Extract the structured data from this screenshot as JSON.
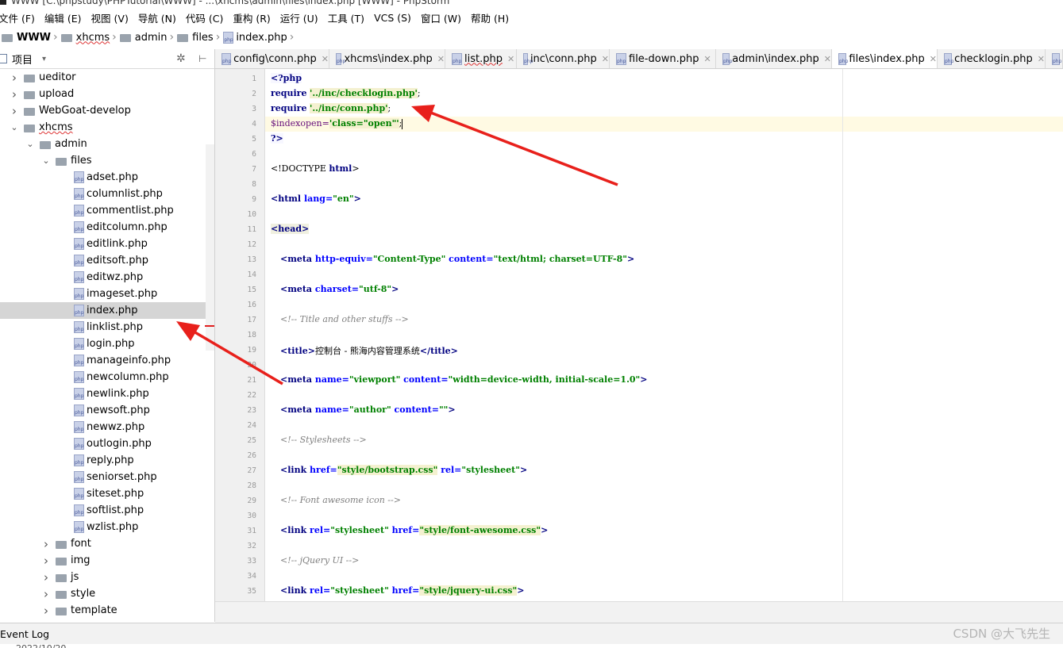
{
  "window": {
    "title": "WWW [C:\\phpstudy\\PHPTutorial\\WWW] - ...\\xhcms\\admin\\files\\index.php [WWW] - PhpStorm"
  },
  "menu": [
    "文件 (F)",
    "编辑 (E)",
    "视图 (V)",
    "导航 (N)",
    "代码 (C)",
    "重构 (R)",
    "运行 (U)",
    "工具 (T)",
    "VCS (S)",
    "窗口 (W)",
    "帮助 (H)"
  ],
  "breadcrumb": [
    "WWW",
    "xhcms",
    "admin",
    "files",
    "index.php"
  ],
  "project": {
    "label": "项目",
    "dropdown": "▾"
  },
  "tree": [
    {
      "label": "ueditor",
      "type": "folder",
      "level": 1,
      "open": false
    },
    {
      "label": "upload",
      "type": "folder",
      "level": 1,
      "open": false
    },
    {
      "label": "WebGoat-develop",
      "type": "folder",
      "level": 1,
      "open": false
    },
    {
      "label": "xhcms",
      "type": "folder",
      "level": 1,
      "open": true
    },
    {
      "label": "admin",
      "type": "folder",
      "level": 2,
      "open": true
    },
    {
      "label": "files",
      "type": "folder",
      "level": 3,
      "open": true
    },
    {
      "label": "adset.php",
      "type": "php",
      "level": 4
    },
    {
      "label": "columnlist.php",
      "type": "php",
      "level": 4
    },
    {
      "label": "commentlist.php",
      "type": "php",
      "level": 4
    },
    {
      "label": "editcolumn.php",
      "type": "php",
      "level": 4
    },
    {
      "label": "editlink.php",
      "type": "php",
      "level": 4
    },
    {
      "label": "editsoft.php",
      "type": "php",
      "level": 4
    },
    {
      "label": "editwz.php",
      "type": "php",
      "level": 4
    },
    {
      "label": "imageset.php",
      "type": "php",
      "level": 4
    },
    {
      "label": "index.php",
      "type": "php",
      "level": 4,
      "selected": true
    },
    {
      "label": "linklist.php",
      "type": "php",
      "level": 4
    },
    {
      "label": "login.php",
      "type": "php",
      "level": 4
    },
    {
      "label": "manageinfo.php",
      "type": "php",
      "level": 4
    },
    {
      "label": "newcolumn.php",
      "type": "php",
      "level": 4
    },
    {
      "label": "newlink.php",
      "type": "php",
      "level": 4
    },
    {
      "label": "newsoft.php",
      "type": "php",
      "level": 4
    },
    {
      "label": "newwz.php",
      "type": "php",
      "level": 4
    },
    {
      "label": "outlogin.php",
      "type": "php",
      "level": 4
    },
    {
      "label": "reply.php",
      "type": "php",
      "level": 4
    },
    {
      "label": "seniorset.php",
      "type": "php",
      "level": 4
    },
    {
      "label": "siteset.php",
      "type": "php",
      "level": 4
    },
    {
      "label": "softlist.php",
      "type": "php",
      "level": 4
    },
    {
      "label": "wzlist.php",
      "type": "php",
      "level": 4
    },
    {
      "label": "font",
      "type": "folder",
      "level": 3,
      "open": false
    },
    {
      "label": "img",
      "type": "folder",
      "level": 3,
      "open": false
    },
    {
      "label": "js",
      "type": "folder",
      "level": 3,
      "open": false
    },
    {
      "label": "style",
      "type": "folder",
      "level": 3,
      "open": false
    },
    {
      "label": "template",
      "type": "folder",
      "level": 3,
      "open": false
    }
  ],
  "tabs": [
    {
      "label": "config\\conn.php",
      "active": false
    },
    {
      "label": "xhcms\\index.php",
      "active": false
    },
    {
      "label": "list.php",
      "active": false
    },
    {
      "label": "inc\\conn.php",
      "active": false
    },
    {
      "label": "file-down.php",
      "active": false
    },
    {
      "label": "admin\\index.php",
      "active": false
    },
    {
      "label": "files\\index.php",
      "active": true
    },
    {
      "label": "checklogin.php",
      "active": false
    }
  ],
  "code": {
    "line_numbers": [
      "1",
      "2",
      "3",
      "4",
      "5",
      "6",
      "7",
      "8",
      "9",
      "10",
      "11",
      "12",
      "13",
      "14",
      "15",
      "16",
      "17",
      "18",
      "19",
      "20",
      "21",
      "22",
      "23",
      "24",
      "25",
      "26",
      "27",
      "28",
      "29",
      "30",
      "31",
      "32",
      "33",
      "34",
      "35"
    ],
    "l1": "<?php",
    "l2_kw": "require",
    "l2_str": "'../inc/checklogin.php'",
    "l2_end": ";",
    "l3_kw": "require",
    "l3_str": "'../inc/conn.php'",
    "l3_end": ";",
    "l4_var": "$index",
    "l4_mid": "open=",
    "l4_str": "'class=\"open\"'",
    "l4_end": ";",
    "l5": "?>",
    "l7_a": "<!DOCTYPE ",
    "l7_b": "html",
    "l7_c": ">",
    "l9_tag": "<html ",
    "l9_attr": "lang=",
    "l9_val": "\"en\"",
    "l9_end": ">",
    "l11": "<head>",
    "l13_tag": "<meta ",
    "l13_a1": "http-equiv=",
    "l13_v1": "\"Content-Type\"",
    "l13_a2": " content=",
    "l13_v2": "\"text/html; charset=UTF-8\"",
    "l13_end": ">",
    "l15_tag": "<meta ",
    "l15_a1": "charset=",
    "l15_v1": "\"utf-8\"",
    "l15_end": ">",
    "l17": "<!-- Title and other stuffs -->",
    "l19_open": "<title>",
    "l19_text": "控制台 - 熊海内容管理系统",
    "l19_close": "</title>",
    "l21_tag": "<meta ",
    "l21_a1": "name=",
    "l21_v1": "\"viewport\"",
    "l21_a2": " content=",
    "l21_v2": "\"width=device-width, initial-scale=1.0\"",
    "l21_end": ">",
    "l23_tag": "<meta ",
    "l23_a1": "name=",
    "l23_v1": "\"author\"",
    "l23_a2": " content=",
    "l23_v2": "\"\"",
    "l23_end": ">",
    "l25": "<!-- Stylesheets -->",
    "l27_tag": "<link ",
    "l27_a1": "href=",
    "l27_v1": "\"style/bootstrap.css\"",
    "l27_a2": " rel=",
    "l27_v2": "\"stylesheet\"",
    "l27_end": ">",
    "l29": "<!-- Font awesome icon -->",
    "l31_tag": "<link ",
    "l31_a1": "rel=",
    "l31_v1": "\"stylesheet\"",
    "l31_a2": " href=",
    "l31_v2": "\"style/font-awesome.css\"",
    "l31_end": ">",
    "l33": "<!-- jQuery UI -->",
    "l35_tag": "<link ",
    "l35_a1": "rel=",
    "l35_v1": "\"stylesheet\"",
    "l35_a2": " href=",
    "l35_v2": "\"style/jquery-ui.css\"",
    "l35_end": ">"
  },
  "status": {
    "event_log": "Event Log",
    "date_cut": "2022/10/20"
  },
  "watermark": "CSDN @大飞先生",
  "colors": {
    "arrow": "#e8201b",
    "selection": "#d5d5d5",
    "current_line": "#fffae3"
  }
}
